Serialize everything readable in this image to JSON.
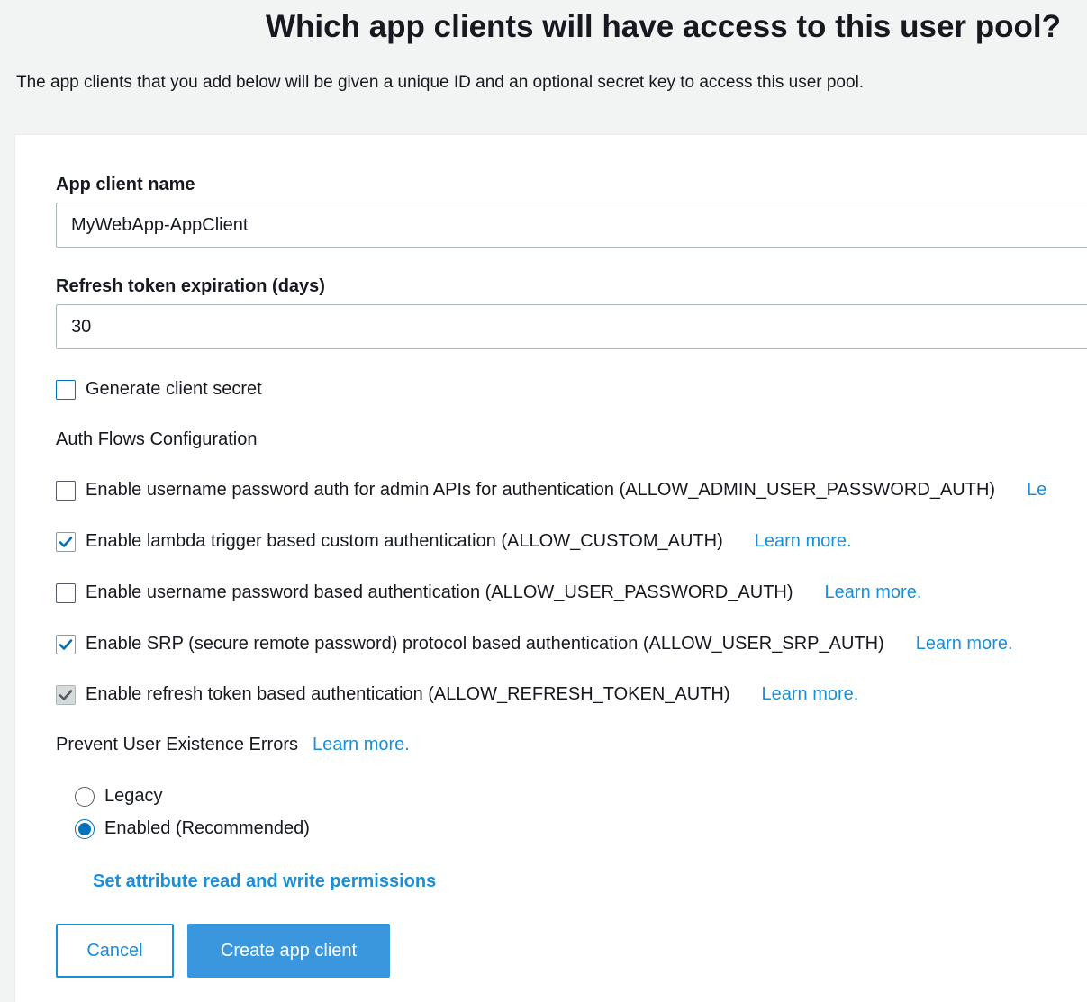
{
  "header": {
    "title": "Which app clients will have access to this user pool?",
    "description": "The app clients that you add below will be given a unique ID and an optional secret key to access this user pool."
  },
  "form": {
    "app_client_name": {
      "label": "App client name",
      "value": "MyWebApp-AppClient"
    },
    "refresh_token": {
      "label": "Refresh token expiration (days)",
      "value": "30"
    },
    "generate_secret": {
      "label": "Generate client secret",
      "checked": false
    },
    "auth_flows": {
      "heading": "Auth Flows Configuration",
      "items": [
        {
          "label": "Enable username password auth for admin APIs for authentication (ALLOW_ADMIN_USER_PASSWORD_AUTH)",
          "checked": false,
          "link": "Le"
        },
        {
          "label": "Enable lambda trigger based custom authentication (ALLOW_CUSTOM_AUTH)",
          "checked": true,
          "link": "Learn more."
        },
        {
          "label": "Enable username password based authentication (ALLOW_USER_PASSWORD_AUTH)",
          "checked": false,
          "link": "Learn more."
        },
        {
          "label": "Enable SRP (secure remote password) protocol based authentication (ALLOW_USER_SRP_AUTH)",
          "checked": true,
          "link": "Learn more."
        },
        {
          "label": "Enable refresh token based authentication (ALLOW_REFRESH_TOKEN_AUTH)",
          "checked": true,
          "disabled": true,
          "link": "Learn more."
        }
      ]
    },
    "prevent_errors": {
      "label": "Prevent User Existence Errors",
      "link": "Learn more.",
      "options": [
        {
          "label": "Legacy",
          "selected": false
        },
        {
          "label": "Enabled (Recommended)",
          "selected": true
        }
      ]
    },
    "attribute_permissions_link": "Set attribute read and write permissions",
    "buttons": {
      "cancel": "Cancel",
      "create": "Create app client"
    }
  },
  "colors": {
    "link": "#1a8fd9",
    "primary_button": "#3b97dd",
    "checkbox_check": "#0073bb",
    "page_bg": "#f2f3f3"
  }
}
